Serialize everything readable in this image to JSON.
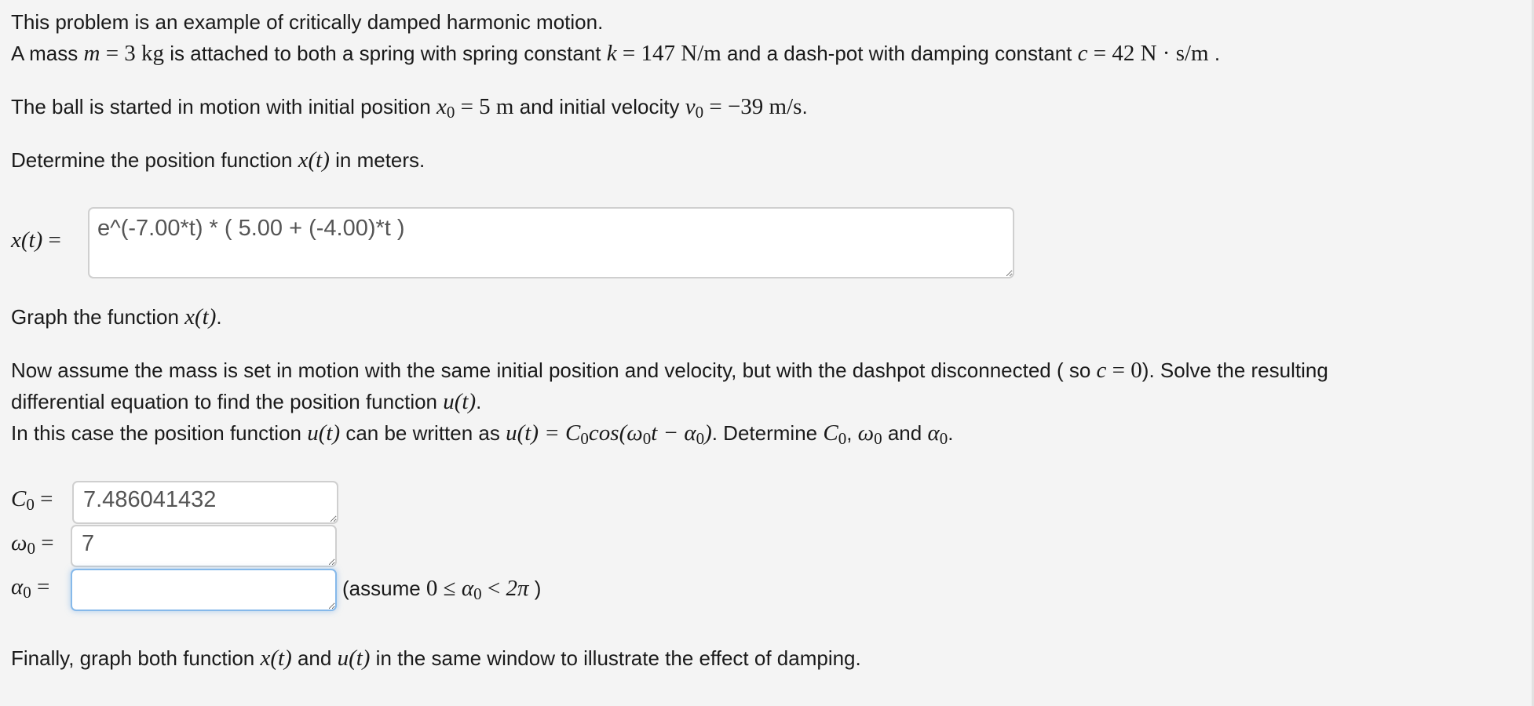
{
  "problem": {
    "intro": "This problem is an example of critically damped harmonic motion.",
    "line2": {
      "t1": "A mass ",
      "m_sym": "m",
      "m_val": " = 3 kg",
      "t2": " is attached to both a spring with spring constant ",
      "k_sym": "k",
      "k_val": " = 147 N/m",
      "t3": " and a dash-pot with damping constant ",
      "c_sym": "c",
      "c_val": " = 42 N · s/m",
      "t4": " ."
    },
    "line3": {
      "t1": "The ball is started in motion with initial position ",
      "x0_sym": "x",
      "x0_sub": "0",
      "x0_val": " = 5 m",
      "t2": " and initial velocity ",
      "v0_sym": "v",
      "v0_sub": "0",
      "v0_val": " = −39 m/s",
      "t3": "."
    },
    "line4": {
      "t1": "Determine the position function ",
      "fx": "x(t)",
      "t2": " in meters."
    },
    "xt_field": {
      "label": "x(t)",
      "eq": " = ",
      "value": "e^(-7.00*t) * ( 5.00 + (-4.00)*t )"
    },
    "graph_x": {
      "t1": "Graph the function ",
      "fx": "x(t)",
      "t2": "."
    },
    "part2": {
      "l1_t1": "Now assume the mass is set in motion with the same initial position and velocity, but with the dashpot disconnected ( so ",
      "l1_c": "c",
      "l1_ceq": " = 0",
      "l1_t2": "). Solve the resulting",
      "l2_t1": "differential equation to find the position function ",
      "l2_fu": "u(t)",
      "l2_t2": ".",
      "l3_t1": "In this case the position function ",
      "l3_fu": "u(t)",
      "l3_t2": " can be written as ",
      "l3_formula_a": "u(t) = C",
      "l3_formula_sub1": "0",
      "l3_formula_b": "cos(ω",
      "l3_formula_sub2": "0",
      "l3_formula_c": "t − α",
      "l3_formula_sub3": "0",
      "l3_formula_d": ")",
      "l3_t3": ". Determine ",
      "l3_C": "C",
      "l3_C_sub": "0",
      "l3_comma": ", ",
      "l3_w": "ω",
      "l3_w_sub": "0",
      "l3_and": " and ",
      "l3_a": "α",
      "l3_a_sub": "0",
      "l3_end": "."
    },
    "fields": {
      "C0": {
        "sym": "C",
        "sub": "0",
        "eq": " = ",
        "value": "7.486041432"
      },
      "w0": {
        "sym": "ω",
        "sub": "0",
        "eq": " = ",
        "value": "7"
      },
      "a0": {
        "sym": "α",
        "sub": "0",
        "eq": " = ",
        "value": ""
      },
      "a0_note": {
        "t1": "(assume ",
        "lower": "0",
        "le": " ≤ ",
        "a": "α",
        "a_sub": "0",
        "lt": " < ",
        "upper": "2π",
        "t2": " )"
      }
    },
    "final": {
      "t1": "Finally, graph both function ",
      "fx": "x(t)",
      "t2": " and ",
      "fu": "u(t)",
      "t3": " in the same window to illustrate the effect of damping."
    }
  }
}
